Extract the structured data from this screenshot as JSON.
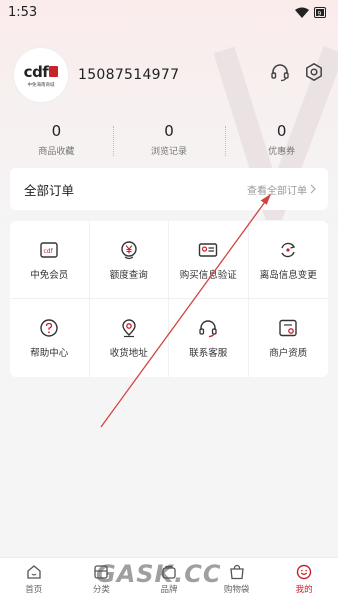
{
  "status_bar": {
    "time": "1:53"
  },
  "profile": {
    "phone": "15087514977",
    "logo_text": "cdf",
    "logo_sub": "中免海南商城"
  },
  "stats": [
    {
      "value": "0",
      "label": "商品收藏"
    },
    {
      "value": "0",
      "label": "浏览记录"
    },
    {
      "value": "0",
      "label": "优惠券"
    }
  ],
  "orders": {
    "title": "全部订单",
    "link": "查看全部订单"
  },
  "services": [
    {
      "label": "中免会员",
      "icon": "membership-card-icon"
    },
    {
      "label": "额度查询",
      "icon": "yuan-quota-icon"
    },
    {
      "label": "购买信息验证",
      "icon": "id-card-icon"
    },
    {
      "label": "离岛信息变更",
      "icon": "refresh-change-icon"
    },
    {
      "label": "帮助中心",
      "icon": "help-icon"
    },
    {
      "label": "收货地址",
      "icon": "location-pin-icon"
    },
    {
      "label": "联系客服",
      "icon": "headset-icon"
    },
    {
      "label": "商户资质",
      "icon": "certificate-icon"
    }
  ],
  "tabs": [
    {
      "label": "首页",
      "icon": "home-icon",
      "active": false
    },
    {
      "label": "分类",
      "icon": "category-icon",
      "active": false
    },
    {
      "label": "品牌",
      "icon": "brand-icon",
      "active": false
    },
    {
      "label": "购物袋",
      "icon": "bag-icon",
      "active": false
    },
    {
      "label": "我的",
      "icon": "profile-icon",
      "active": true
    }
  ],
  "watermark": "GASK.CC",
  "colors": {
    "accent": "#c8232c",
    "annotation_arrow": "#d2453f"
  }
}
